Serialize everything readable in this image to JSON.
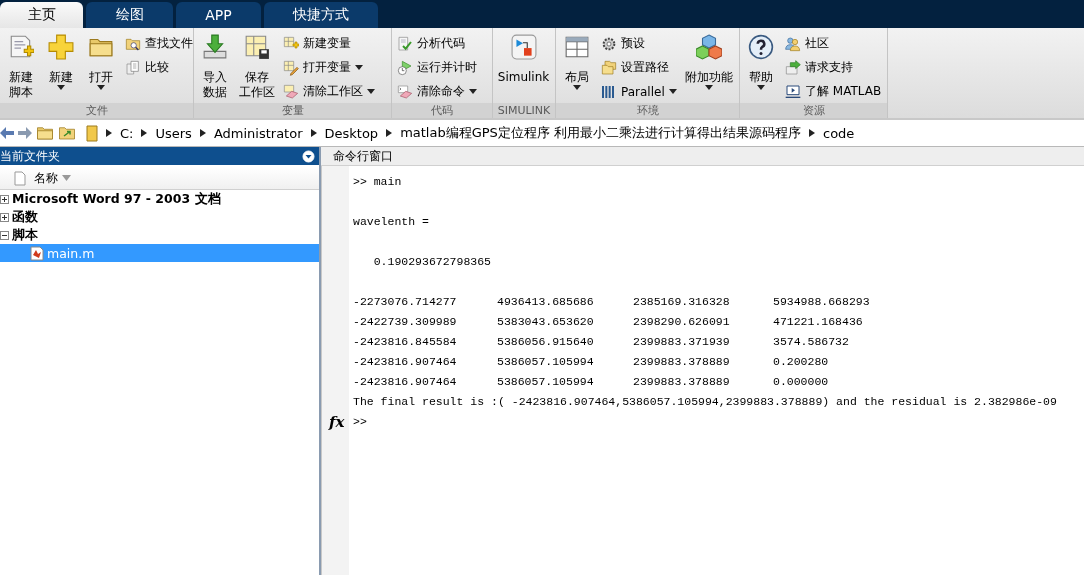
{
  "tabs": [
    {
      "label": "主页",
      "selected": true
    },
    {
      "label": "绘图",
      "selected": false
    },
    {
      "label": "APP",
      "selected": false
    },
    {
      "label": "快捷方式",
      "selected": false
    }
  ],
  "ribbon": {
    "groups": [
      {
        "title": "文件",
        "columns": [
          {
            "kind": "large",
            "lines": [
              "新建",
              "脚本"
            ],
            "dropdown": false
          },
          {
            "kind": "large",
            "lines": [
              "新建"
            ],
            "dropdown": true
          },
          {
            "kind": "large",
            "lines": [
              "打开"
            ],
            "dropdown": true
          },
          {
            "kind": "stack",
            "items": [
              {
                "label": "查找文件",
                "dropdown": false
              },
              {
                "label": "比较",
                "dropdown": false
              }
            ]
          }
        ]
      },
      {
        "title": "变量",
        "columns": [
          {
            "kind": "large",
            "lines": [
              "导入",
              "数据"
            ],
            "dropdown": false
          },
          {
            "kind": "large",
            "lines": [
              "保存",
              "工作区"
            ],
            "dropdown": false
          },
          {
            "kind": "stack",
            "items": [
              {
                "label": "新建变量",
                "dropdown": false
              },
              {
                "label": "打开变量",
                "dropdown": true
              },
              {
                "label": "清除工作区",
                "dropdown": true
              }
            ]
          }
        ]
      },
      {
        "title": "代码",
        "columns": [
          {
            "kind": "stack",
            "items": [
              {
                "label": "分析代码",
                "dropdown": false
              },
              {
                "label": "运行并计时",
                "dropdown": false
              },
              {
                "label": "清除命令",
                "dropdown": true
              }
            ]
          }
        ]
      },
      {
        "title": "SIMULINK",
        "columns": [
          {
            "kind": "large",
            "lines": [
              "Simulink"
            ],
            "dropdown": false
          }
        ]
      },
      {
        "title": "环境",
        "columns": [
          {
            "kind": "large",
            "lines": [
              "布局"
            ],
            "dropdown": true
          },
          {
            "kind": "stack",
            "items": [
              {
                "label": "预设",
                "dropdown": false
              },
              {
                "label": "设置路径",
                "dropdown": false
              },
              {
                "label": "Parallel",
                "dropdown": true
              }
            ]
          },
          {
            "kind": "large",
            "lines": [
              "附加功能"
            ],
            "dropdown": true
          }
        ]
      },
      {
        "title": "资源",
        "columns": [
          {
            "kind": "large",
            "lines": [
              "帮助"
            ],
            "dropdown": true
          },
          {
            "kind": "stack",
            "items": [
              {
                "label": "社区",
                "dropdown": false
              },
              {
                "label": "请求支持",
                "dropdown": false
              },
              {
                "label": "了解 MATLAB",
                "dropdown": false
              }
            ]
          }
        ]
      }
    ]
  },
  "address": {
    "path": [
      "C:",
      "Users",
      "Administrator",
      "Desktop",
      "matlab编程GPS定位程序 利用最小二乘法进行计算得出结果源码程序",
      "code"
    ]
  },
  "files": {
    "title": "当前文件夹",
    "column": "名称",
    "tree": [
      {
        "label": "Microsoft Word 97 - 2003 文档",
        "expanded": false,
        "selected": false
      },
      {
        "label": "函数",
        "expanded": false,
        "selected": false
      },
      {
        "label": "脚本",
        "expanded": true,
        "selected": false,
        "children": [
          {
            "label": "main.m",
            "selected": true
          }
        ]
      }
    ]
  },
  "command": {
    "title": "命令行窗口",
    "lines": [
      {
        "kind": "input",
        "prompt": ">>",
        "text": "main"
      },
      {
        "kind": "blank"
      },
      {
        "kind": "output",
        "text": "wavelenth ="
      },
      {
        "kind": "blank"
      },
      {
        "kind": "output",
        "text": "   0.190293672798365"
      },
      {
        "kind": "blank"
      },
      {
        "kind": "row",
        "cells": [
          "-2273076.714277",
          "4936413.685686",
          "2385169.316328",
          "5934988.668293"
        ]
      },
      {
        "kind": "row",
        "cells": [
          "-2422739.309989",
          "5383043.653620",
          "2398290.626091",
          "471221.168436"
        ]
      },
      {
        "kind": "row",
        "cells": [
          "-2423816.845584",
          "5386056.915640",
          "2399883.371939",
          "3574.586732"
        ]
      },
      {
        "kind": "row",
        "cells": [
          "-2423816.907464",
          "5386057.105994",
          "2399883.378889",
          "0.200280"
        ]
      },
      {
        "kind": "row",
        "cells": [
          "-2423816.907464",
          "5386057.105994",
          "2399883.378889",
          "0.000000"
        ]
      },
      {
        "kind": "output",
        "text": "The final result is :( -2423816.907464,5386057.105994,2399883.378889) and the residual is 2.382986e-09"
      },
      {
        "kind": "input",
        "prompt": ">>",
        "marker": "fx"
      }
    ]
  }
}
